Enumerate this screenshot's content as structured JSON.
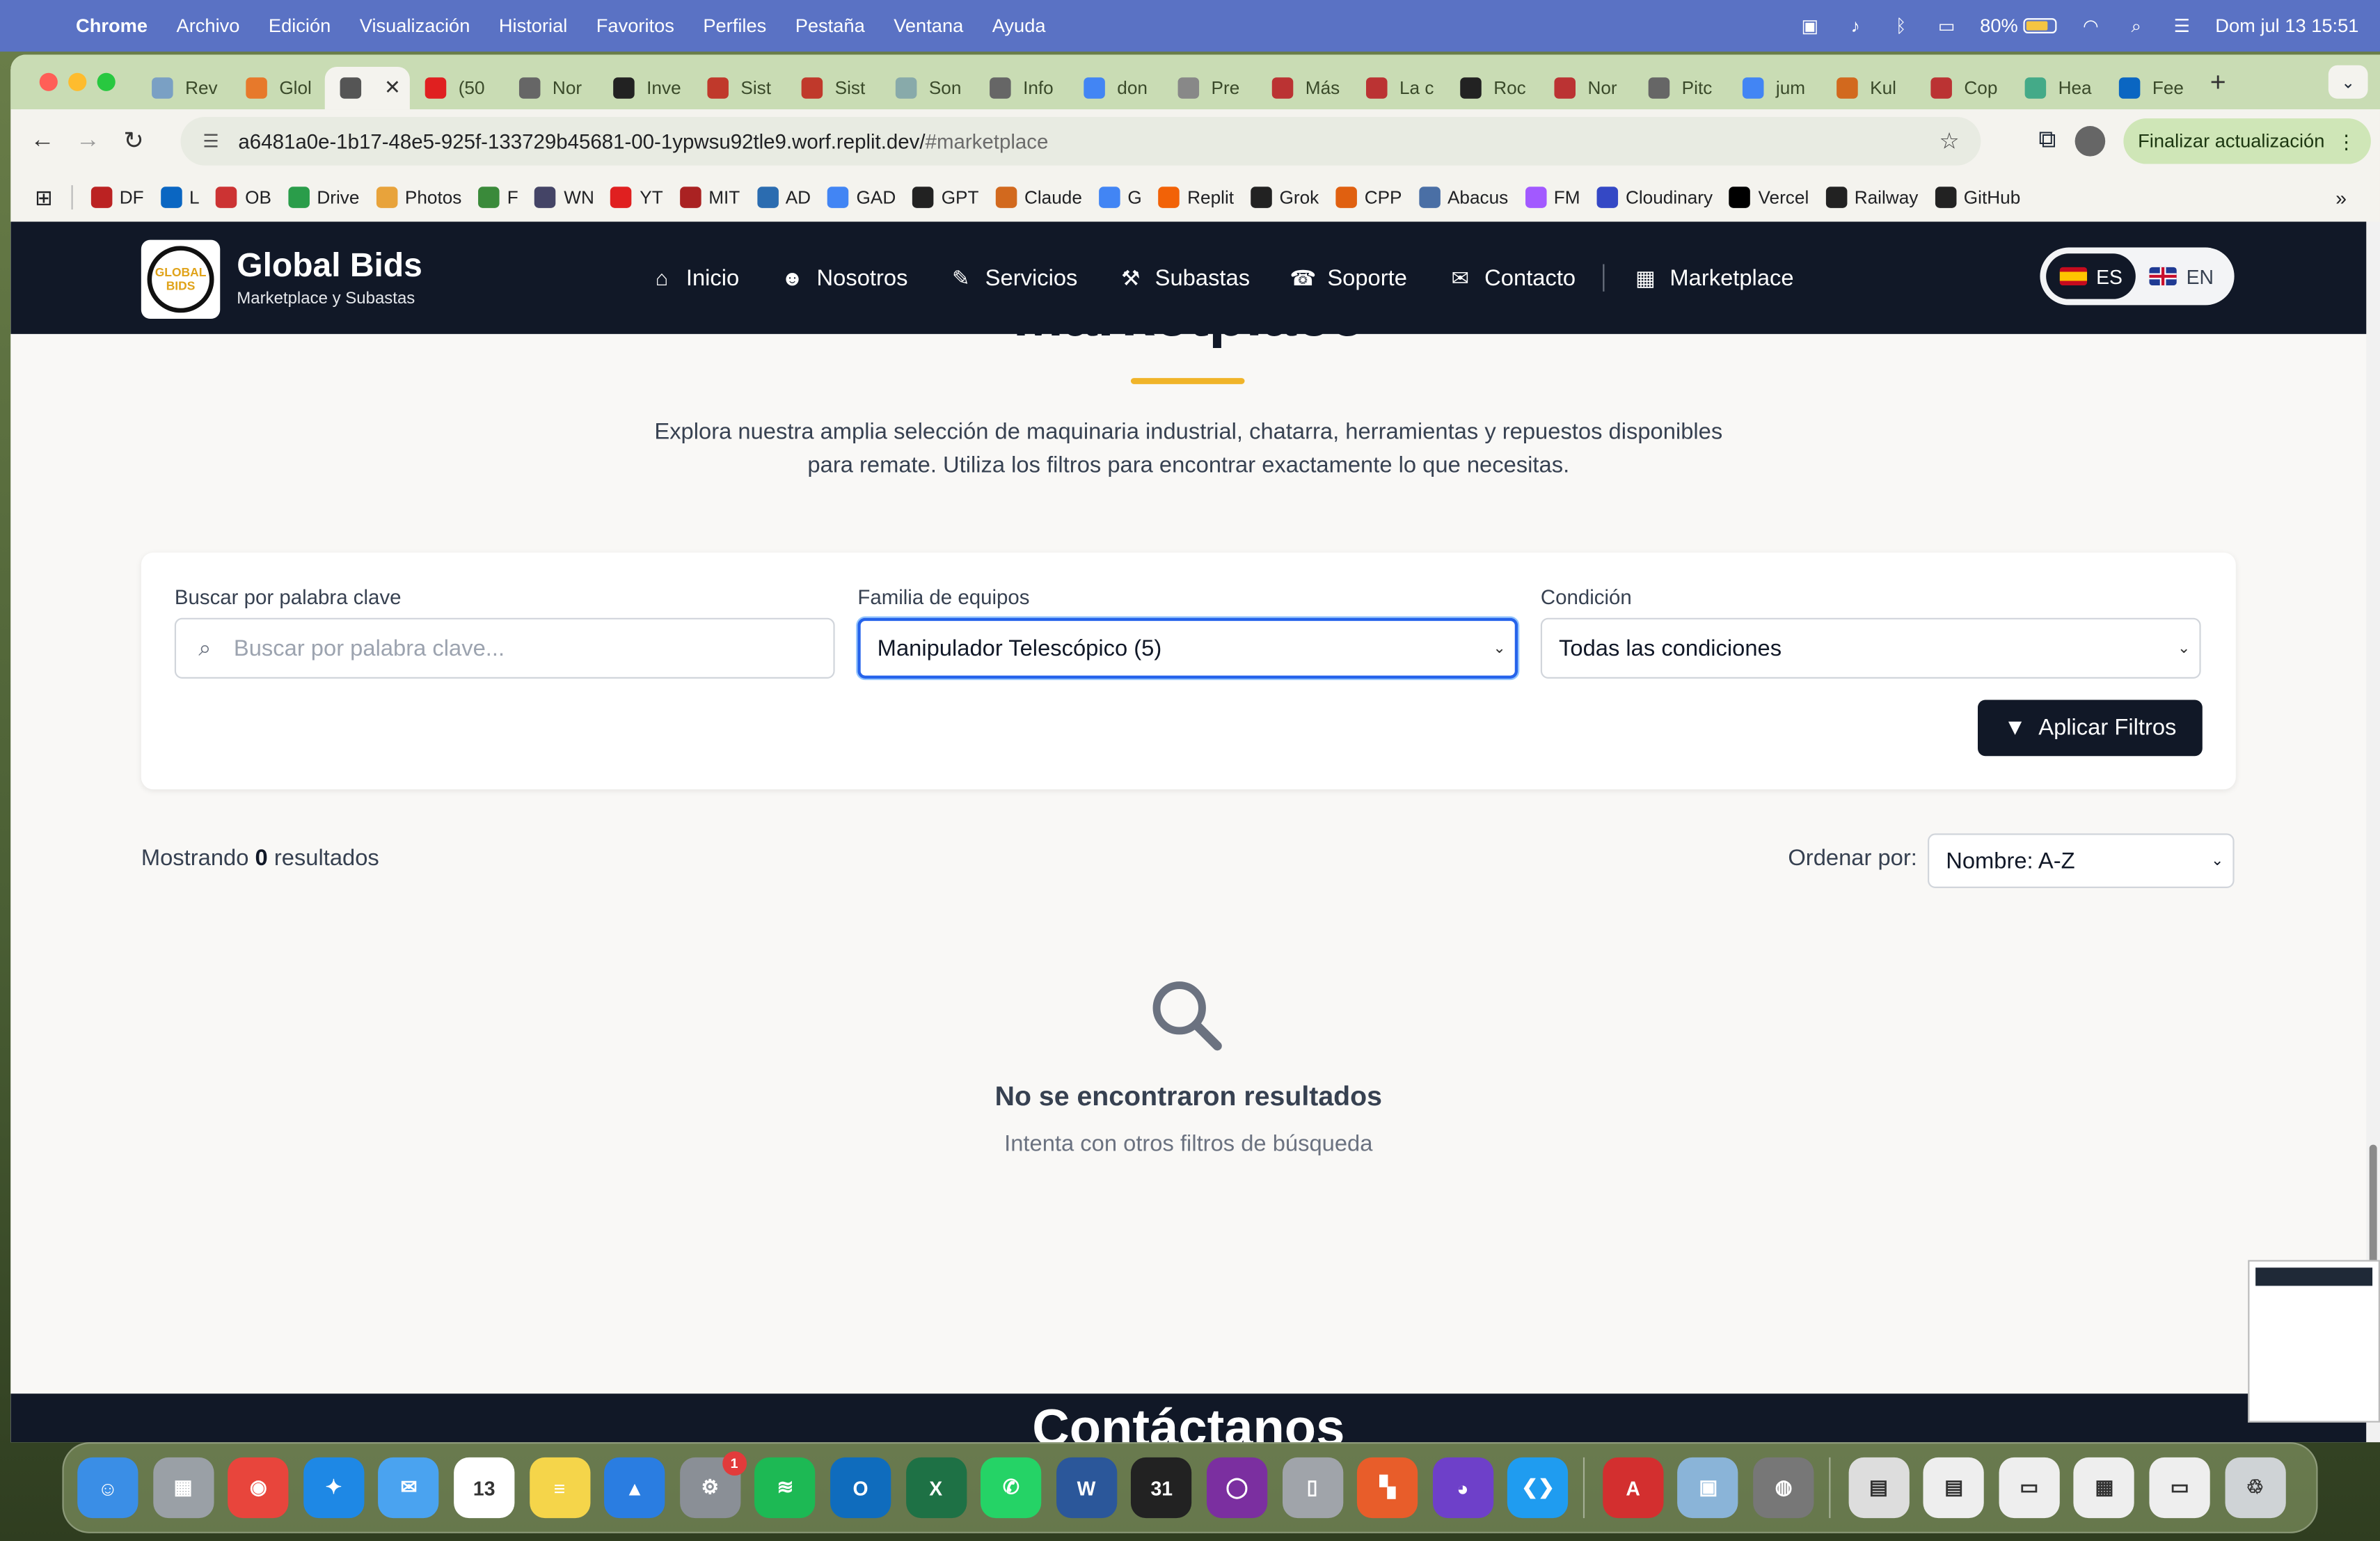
{
  "menubar": {
    "items": [
      "Chrome",
      "Archivo",
      "Edición",
      "Visualización",
      "Historial",
      "Favoritos",
      "Perfiles",
      "Pestaña",
      "Ventana",
      "Ayuda"
    ],
    "battery": "80%",
    "datetime": "Dom jul 13  15:51"
  },
  "tabs": [
    {
      "label": "Rev",
      "color": "#7aa0c4"
    },
    {
      "label": "Glol",
      "color": "#e7792b"
    },
    {
      "label": "",
      "color": "#555"
    },
    {
      "label": "(50",
      "color": "#e02020"
    },
    {
      "label": "Nor",
      "color": "#666"
    },
    {
      "label": "Inve",
      "color": "#222"
    },
    {
      "label": "Sist",
      "color": "#c0392b"
    },
    {
      "label": "Sist",
      "color": "#c0392b"
    },
    {
      "label": "Son",
      "color": "#8aa"
    },
    {
      "label": "Info",
      "color": "#666"
    },
    {
      "label": "don",
      "color": "#4285f4"
    },
    {
      "label": "Pre",
      "color": "#888"
    },
    {
      "label": "Más",
      "color": "#b33"
    },
    {
      "label": "La c",
      "color": "#b33"
    },
    {
      "label": "Roc",
      "color": "#222"
    },
    {
      "label": "Nor",
      "color": "#b33"
    },
    {
      "label": "Pitc",
      "color": "#666"
    },
    {
      "label": "jum",
      "color": "#4285f4"
    },
    {
      "label": "Kul",
      "color": "#d2691e"
    },
    {
      "label": "Cop",
      "color": "#b33"
    },
    {
      "label": "Hea",
      "color": "#4a8"
    },
    {
      "label": "Fee",
      "color": "#0a66c2"
    }
  ],
  "address": {
    "url": "a6481a0e-1b17-48e5-925f-133729b45681-00-1ypwsu92tle9.worf.replit.dev/",
    "hash": "#marketplace",
    "update_label": "Finalizar actualización"
  },
  "bookmarks": [
    {
      "label": "DF",
      "color": "#b22"
    },
    {
      "label": "L",
      "color": "#0a66c2"
    },
    {
      "label": "OB",
      "color": "#c33"
    },
    {
      "label": "Drive",
      "color": "#2a9d4a"
    },
    {
      "label": "Photos",
      "color": "#e8a33b"
    },
    {
      "label": "F",
      "color": "#3a8a3a"
    },
    {
      "label": "WN",
      "color": "#446"
    },
    {
      "label": "YT",
      "color": "#e02020"
    },
    {
      "label": "MIT",
      "color": "#a22"
    },
    {
      "label": "AD",
      "color": "#2b6cb0"
    },
    {
      "label": "GAD",
      "color": "#4285f4"
    },
    {
      "label": "GPT",
      "color": "#222"
    },
    {
      "label": "Claude",
      "color": "#d2691e"
    },
    {
      "label": "G",
      "color": "#4285f4"
    },
    {
      "label": "Replit",
      "color": "#f26207"
    },
    {
      "label": "Grok",
      "color": "#222"
    },
    {
      "label": "CPP",
      "color": "#e06010"
    },
    {
      "label": "Abacus",
      "color": "#4a6fa5"
    },
    {
      "label": "FM",
      "color": "#a259ff"
    },
    {
      "label": "Cloudinary",
      "color": "#3448c5"
    },
    {
      "label": "Vercel",
      "color": "#000"
    },
    {
      "label": "Railway",
      "color": "#222"
    },
    {
      "label": "GitHub",
      "color": "#222"
    }
  ],
  "site": {
    "brand": "Global Bids",
    "tagline": "Marketplace y Subastas",
    "logo_text": "GLOBAL BIDS",
    "nav": [
      {
        "label": "Inicio",
        "icon": "home-icon",
        "glyph": "⌂"
      },
      {
        "label": "Nosotros",
        "icon": "users-icon",
        "glyph": "☻"
      },
      {
        "label": "Servicios",
        "icon": "wrench-icon",
        "glyph": "✎"
      },
      {
        "label": "Subastas",
        "icon": "gavel-icon",
        "glyph": "⚒"
      },
      {
        "label": "Soporte",
        "icon": "headset-icon",
        "glyph": "☎"
      },
      {
        "label": "Contacto",
        "icon": "envelope-icon",
        "glyph": "✉"
      },
      {
        "label": "Marketplace",
        "icon": "grid-icon",
        "glyph": "▦"
      }
    ],
    "lang": {
      "es": "ES",
      "en": "EN"
    }
  },
  "marketplace": {
    "heading": "Marketplace",
    "intro": "Explora nuestra amplia selección de maquinaria industrial, chatarra, herramientas y repuestos disponibles para remate. Utiliza los filtros para encontrar exactamente lo que necesitas.",
    "search_label": "Buscar por palabra clave",
    "search_placeholder": "Buscar por palabra clave...",
    "family_label": "Familia de equipos",
    "family_value": "Manipulador Telescópico (5)",
    "condition_label": "Condición",
    "condition_value": "Todas las condiciones",
    "apply_label": "Aplicar Filtros",
    "results_prefix": "Mostrando ",
    "results_count": "0",
    "results_suffix": " resultados",
    "sort_label": "Ordenar por:",
    "sort_value": "Nombre: A-Z",
    "empty_title": "No se encontraron resultados",
    "empty_sub": "Intenta con otros filtros de búsqueda",
    "contact_heading": "Contáctanos"
  },
  "dock": [
    {
      "name": "finder",
      "color": "#3a8ee6",
      "glyph": "☺"
    },
    {
      "name": "launchpad",
      "color": "#9aa0a6",
      "glyph": "▦"
    },
    {
      "name": "chrome",
      "color": "#e8453c",
      "glyph": "◉"
    },
    {
      "name": "safari",
      "color": "#1e88e5",
      "glyph": "✦"
    },
    {
      "name": "mail",
      "color": "#4aa3f0",
      "glyph": "✉"
    },
    {
      "name": "calendar",
      "color": "#ffffff",
      "glyph": "13"
    },
    {
      "name": "notes",
      "color": "#f5d54a",
      "glyph": "≡"
    },
    {
      "name": "keynote",
      "color": "#2a7de1",
      "glyph": "▲"
    },
    {
      "name": "settings",
      "color": "#8a8f96",
      "glyph": "⚙",
      "badge": "1"
    },
    {
      "name": "spotify",
      "color": "#1db954",
      "glyph": "≋"
    },
    {
      "name": "outlook",
      "color": "#0f6cbd",
      "glyph": "O"
    },
    {
      "name": "excel",
      "color": "#1e7145",
      "glyph": "X"
    },
    {
      "name": "whatsapp",
      "color": "#25d366",
      "glyph": "✆"
    },
    {
      "name": "word",
      "color": "#2b579a",
      "glyph": "W"
    },
    {
      "name": "calendar31",
      "color": "#222",
      "glyph": "31"
    },
    {
      "name": "circle-app",
      "color": "#7b2fa0",
      "glyph": "◯"
    },
    {
      "name": "iphone-mirroring",
      "color": "#a0a4aa",
      "glyph": "▯"
    },
    {
      "name": "grid-app",
      "color": "#e85d2a",
      "glyph": "▚"
    },
    {
      "name": "github-desktop",
      "color": "#6e40c9",
      "glyph": "◕"
    },
    {
      "name": "vscode",
      "color": "#1f9cf0",
      "glyph": "❮❯"
    },
    {
      "name": "acrobat",
      "color": "#d32f2f",
      "glyph": "A"
    },
    {
      "name": "preview",
      "color": "#8ab4d8",
      "glyph": "▣"
    },
    {
      "name": "earth-pro",
      "color": "#777",
      "glyph": "◍"
    },
    {
      "name": "doc-stack",
      "color": "#ddd",
      "glyph": "▤"
    },
    {
      "name": "pdf-stack",
      "color": "#eee",
      "glyph": "▤"
    },
    {
      "name": "screen-stack",
      "color": "#eee",
      "glyph": "▭"
    },
    {
      "name": "sheet-stack",
      "color": "#eee",
      "glyph": "▦"
    },
    {
      "name": "terminal-stack",
      "color": "#eee",
      "glyph": "▭"
    },
    {
      "name": "trash",
      "color": "#cfd3d6",
      "glyph": "♲"
    }
  ]
}
